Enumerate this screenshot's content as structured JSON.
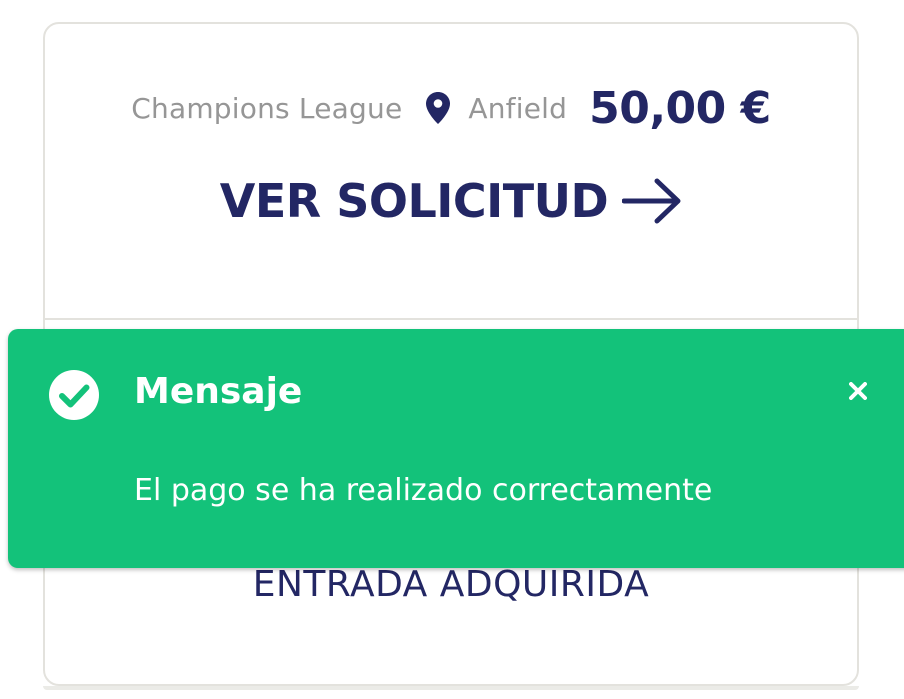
{
  "card": {
    "competition": "Champions League",
    "venue": "Anfield",
    "price": "50,00 €",
    "view_request_label": "VER SOLICITUD",
    "status_label": "ENTRADA ADQUIRIDA"
  },
  "toast": {
    "title": "Mensaje",
    "message": "El pago se ha realizado correctamente",
    "close_symbol": "×"
  },
  "colors": {
    "brand_navy": "#232764",
    "muted_text": "#969696",
    "success_green": "#13c27a",
    "card_border": "#e3e2dd"
  },
  "icons": {
    "venue": "location-pin-icon",
    "view_request": "arrow-right-icon",
    "toast_status": "check-circle-icon",
    "toast_close": "close-icon"
  }
}
